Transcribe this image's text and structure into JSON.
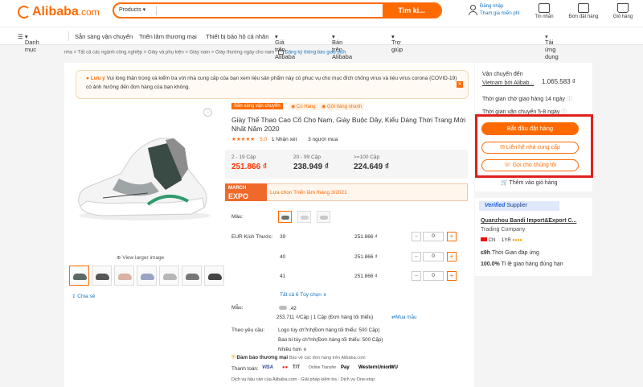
{
  "header": {
    "logo_text": "Alibaba",
    "logo_domain": ".com",
    "search_category": "Products",
    "search_button": "Tìm ki...",
    "signin": "Đăng nhập",
    "join": "Tham gia miễn phí",
    "messages": "Tin nhắn",
    "orders": "Đơn đặt hàng",
    "cart": "Giỏ hàng"
  },
  "nav": {
    "categories": "Danh mục",
    "items": [
      "Sẵn sàng vận chuyển",
      "Triển lãm thương mại",
      "Thiết bị bảo hộ cá nhân",
      "Giá trên Alibaba",
      "Bán trên Alibaba",
      "Trợ giúp"
    ],
    "app": "Tải ứng dụng"
  },
  "breadcrumb": {
    "text": "nha > Tất cả các ngành công nghiệp > Giày và phụ kiện > Giày nam > Giày thường ngày cho nam",
    "link": "Đăng ký thông báo giao dịch"
  },
  "notice": {
    "tag": "Lưu ý",
    "text": "Vui lòng thận trọng và kiểm tra với nhà cung cấp của bạn xem liệu sản phẩm này có phục vụ cho mục đích chống virus và liệu virus corona (COVID-19) có ảnh hưởng đến đơn hàng của bạn không."
  },
  "gallery": {
    "view_larger": "View larger image",
    "share": "Chia sẻ",
    "thumb_count": 7
  },
  "product": {
    "badge_ready": "Sẵn sàng vận chuyển",
    "badge_stock": "Có Hàng",
    "badge_fast": "Gửi hàng nhanh",
    "title": "Giày Thể Thao Cao Cổ Cho Nam, Giày Buộc Dây, Kiểu Dáng Thời Trang Mới Nhất Năm 2020",
    "rating_stars": "★★★★★",
    "rating": "5.0",
    "reviews": "1 Nhận xét",
    "buyers": "3 người mua"
  },
  "prices": [
    {
      "range": "2 - 19 Cặp",
      "price": "251.866 ₫"
    },
    {
      "range": "20 - 99 Cặp",
      "price": "238.949 ₫"
    },
    {
      "range": ">=100 Cặp",
      "price": "224.649 ₫"
    }
  ],
  "expo": {
    "line1": "MARCH",
    "line2": "EXPO",
    "text": "Lựa chọn Triển lãm tháng 3/2021"
  },
  "options": {
    "color_label": "Màu:",
    "size_label": "EUR Kích Thước:",
    "sizes": [
      {
        "size": "39",
        "price": "251.866 ₫",
        "qty": "0"
      },
      {
        "size": "40",
        "price": "251.866 ₫",
        "qty": "0"
      },
      {
        "size": "41",
        "price": "251.866 ₫",
        "qty": "0"
      }
    ],
    "all_link": "Tất cả 6 Tùy chọn ∨"
  },
  "sample": {
    "label": "Mẫu:",
    "size": ",42",
    "price": "253.711 ₫/Cặp | 1 Cặp (Đơn hàng tối thiểu)",
    "buy": "Mua mẫu"
  },
  "customize": {
    "label": "Theo yêu cầu:",
    "logo": "Logo tùy ch?nh(Đơn hàng tối thiểu: 500 Cặp)",
    "pack": "Bao bì tùy ch?nh(Đơn hàng tối thiểu: 500 Cặp)",
    "more": "Nhiều hơn ∨"
  },
  "assurance": {
    "title": "Đảm bảo thương mại",
    "desc": "Bảo vệ các đơn hàng trên Alibaba.com",
    "pay_label": "Thanh toán:",
    "methods": [
      "VISA",
      "●●",
      "T/T",
      "Online Transfer",
      "Pay",
      "WesternUnion",
      "WU"
    ],
    "services": "Dịch vụ hậu cần của Alibaba.com  ·  Giải pháp kiểm tra  ·  Dịch vụ One-stop"
  },
  "side": {
    "ship_to": "Vận chuyển đến",
    "ship_via": "Vietnam bởi Alibab...",
    "ship_price": "1.065.583 ₫",
    "lead": "Thời gian chờ giao hàng 14 ngày",
    "transit": "Thời gian vận chuyển 5-8 ngày",
    "start_order": "Bắt đầu đặt hàng",
    "contact": "Liên hệ nhà cung cấp",
    "call": "Gọi cho chúng tôi",
    "add_cart": "Thêm vào giỏ hàng"
  },
  "supplier": {
    "verified": "Verified",
    "verified_tail": "Supplier",
    "name": "Quanzhou Bandi Import&Export C...",
    "type": "Trading Company",
    "country": "CN",
    "years": "1YR",
    "response_val": "≤9h",
    "response": "Thời Gian đáp ứng",
    "ontime_val": "100.0%",
    "ontime": "Tỉ lệ giao hàng đúng hạn"
  }
}
